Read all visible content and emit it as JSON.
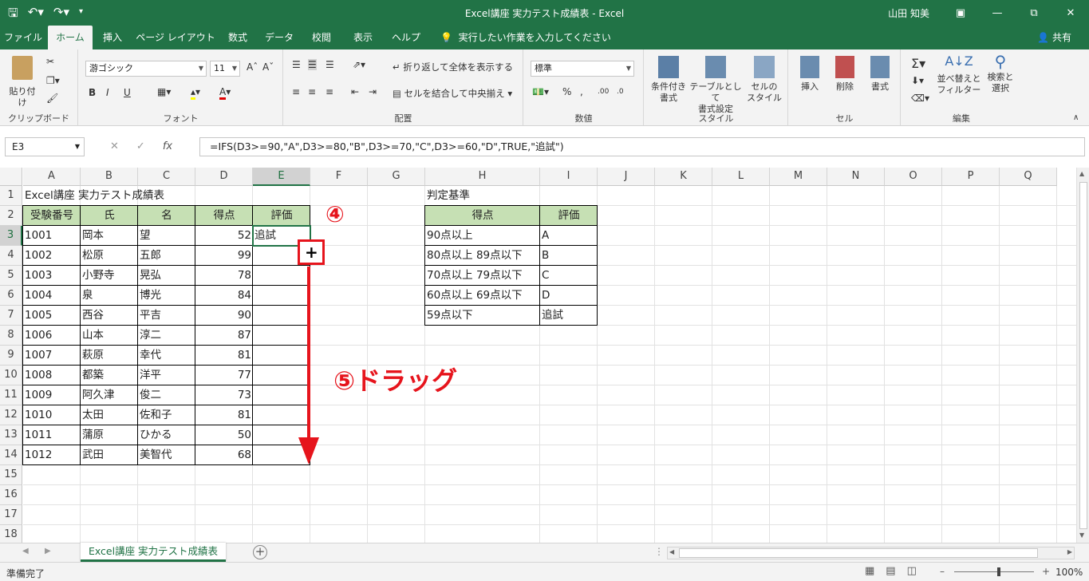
{
  "window": {
    "title": "Excel講座 実力テスト成績表  -  Excel",
    "user": "山田 知美",
    "qat": [
      "save-icon",
      "undo-icon",
      "redo-icon",
      "customize-icon"
    ]
  },
  "tabs": [
    "ファイル",
    "ホーム",
    "挿入",
    "ページ レイアウト",
    "数式",
    "データ",
    "校閲",
    "表示",
    "ヘルプ"
  ],
  "active_tab": "ホーム",
  "tell_me": "実行したい作業を入力してください",
  "share": "共有",
  "ribbon": {
    "clipboard": {
      "paste": "貼り付け",
      "label": "クリップボード"
    },
    "font": {
      "name": "游ゴシック",
      "size": "11",
      "label": "フォント",
      "bold": "B",
      "italic": "I",
      "underline": "U"
    },
    "alignment": {
      "wrap": "折り返して全体を表示する",
      "merge": "セルを結合して中央揃え",
      "label": "配置"
    },
    "number": {
      "format": "標準",
      "label": "数値"
    },
    "styles": {
      "cond": "条件付き",
      "cond2": "書式",
      "table": "テーブルとして",
      "table2": "書式設定",
      "cell": "セルの",
      "cell2": "スタイル",
      "label": "スタイル"
    },
    "cells": {
      "insert": "挿入",
      "delete": "削除",
      "format": "書式",
      "label": "セル"
    },
    "editing": {
      "sort": "並べ替えと",
      "sort2": "フィルター",
      "find": "検索と",
      "find2": "選択",
      "label": "編集"
    }
  },
  "formula_bar": {
    "name_box": "E3",
    "formula": "=IFS(D3>=90,\"A\",D3>=80,\"B\",D3>=70,\"C\",D3>=60,\"D\",TRUE,\"追試\")"
  },
  "columns": [
    "A",
    "B",
    "C",
    "D",
    "E",
    "F",
    "G",
    "H",
    "I",
    "J",
    "K",
    "L",
    "M",
    "N",
    "O",
    "P",
    "Q"
  ],
  "rows": [
    "1",
    "2",
    "3",
    "4",
    "5",
    "6",
    "7",
    "8",
    "9",
    "10",
    "11",
    "12",
    "13",
    "14",
    "15",
    "16",
    "17",
    "18"
  ],
  "sheet": {
    "title": "Excel講座 実力テスト成績表",
    "headers": [
      "受験番号",
      "氏",
      "名",
      "得点",
      "評価"
    ],
    "records": [
      [
        "1001",
        "岡本",
        "望",
        "52",
        "追試"
      ],
      [
        "1002",
        "松原",
        "五郎",
        "99",
        ""
      ],
      [
        "1003",
        "小野寺",
        "晃弘",
        "78",
        ""
      ],
      [
        "1004",
        "泉",
        "博光",
        "84",
        ""
      ],
      [
        "1005",
        "西谷",
        "平吉",
        "90",
        ""
      ],
      [
        "1006",
        "山本",
        "淳二",
        "87",
        ""
      ],
      [
        "1007",
        "萩原",
        "幸代",
        "81",
        ""
      ],
      [
        "1008",
        "都築",
        "洋平",
        "77",
        ""
      ],
      [
        "1009",
        "阿久津",
        "俊二",
        "73",
        ""
      ],
      [
        "1010",
        "太田",
        "佐和子",
        "81",
        ""
      ],
      [
        "1011",
        "蒲原",
        "ひかる",
        "50",
        ""
      ],
      [
        "1012",
        "武田",
        "美智代",
        "68",
        ""
      ]
    ],
    "criteria_title": "判定基準",
    "criteria_headers": [
      "得点",
      "評価"
    ],
    "criteria": [
      [
        "90点以上",
        "A"
      ],
      [
        "80点以上 89点以下",
        "B"
      ],
      [
        "70点以上 79点以下",
        "C"
      ],
      [
        "60点以上 69点以下",
        "D"
      ],
      [
        "59点以下",
        "追試"
      ]
    ]
  },
  "annotations": {
    "step4": "④",
    "step5": "⑤ドラッグ",
    "color": "#e6141c"
  },
  "sheet_tab": "Excel講座 実力テスト成績表",
  "status": {
    "ready": "準備完了",
    "zoom": "100%"
  },
  "colors": {
    "accent": "#217346",
    "header_fill": "#c6e0b4"
  }
}
